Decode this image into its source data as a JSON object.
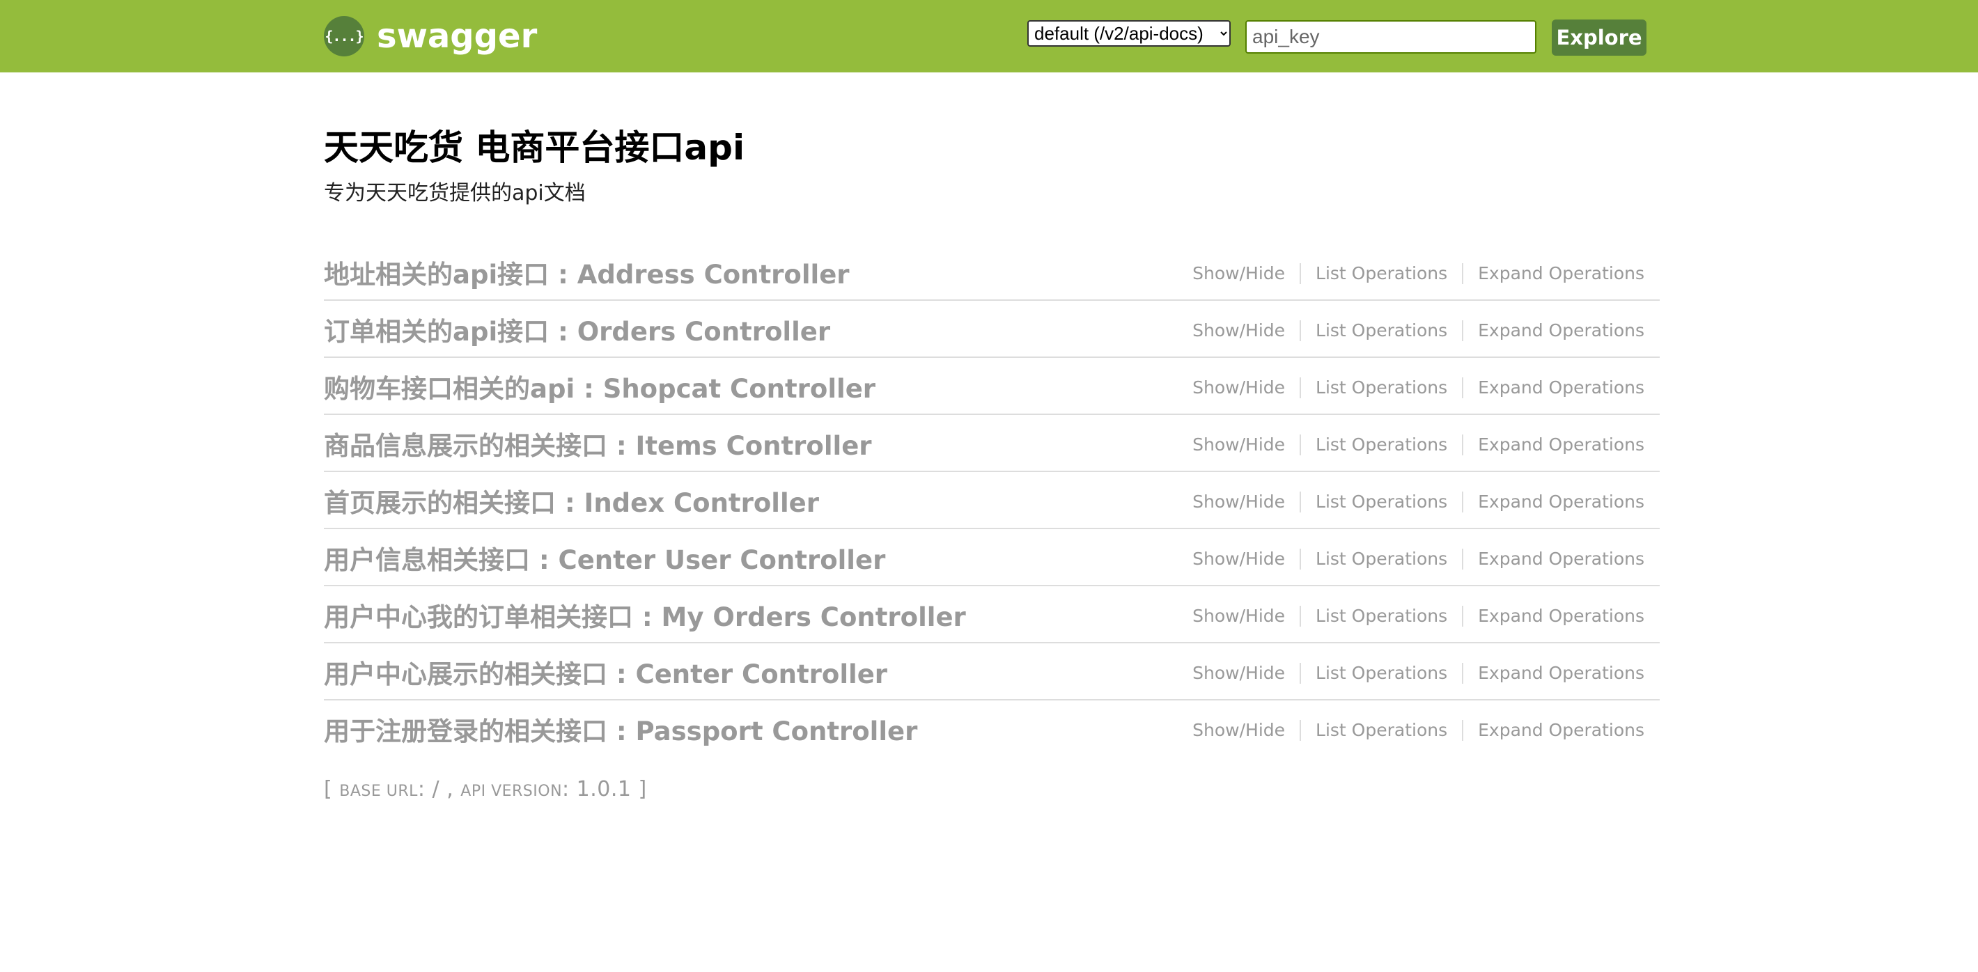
{
  "header": {
    "logo_glyph": "{...}",
    "brand": "swagger",
    "spec_select": {
      "selected": "default (/v2/api-docs)"
    },
    "api_key": {
      "placeholder": "api_key",
      "value": ""
    },
    "explore_label": "Explore"
  },
  "info": {
    "title": "天天吃货 电商平台接口api",
    "description": "专为天天吃货提供的api文档"
  },
  "resources": [
    {
      "name": "地址相关的api接口 : Address Controller"
    },
    {
      "name": "订单相关的api接口 : Orders Controller"
    },
    {
      "name": "购物车接口相关的api : Shopcat Controller"
    },
    {
      "name": "商品信息展示的相关接口 : Items Controller"
    },
    {
      "name": "首页展示的相关接口 : Index Controller"
    },
    {
      "name": "用户信息相关接口 : Center User Controller"
    },
    {
      "name": "用户中心我的订单相关接口 : My Orders Controller"
    },
    {
      "name": "用户中心展示的相关接口 : Center Controller"
    },
    {
      "name": "用于注册登录的相关接口 : Passport Controller"
    }
  ],
  "resource_ops": {
    "show_hide": "Show/Hide",
    "list": "List Operations",
    "expand": "Expand Operations"
  },
  "footer": {
    "open_bracket": "[ ",
    "base_url_label": "base url",
    "base_url_value": ": / , ",
    "api_version_label": "api version",
    "api_version_value": ": 1.0.1 ]"
  },
  "colors": {
    "header_bg": "#94bc3c",
    "accent_dark": "#56803a",
    "resource_text": "#999999"
  }
}
